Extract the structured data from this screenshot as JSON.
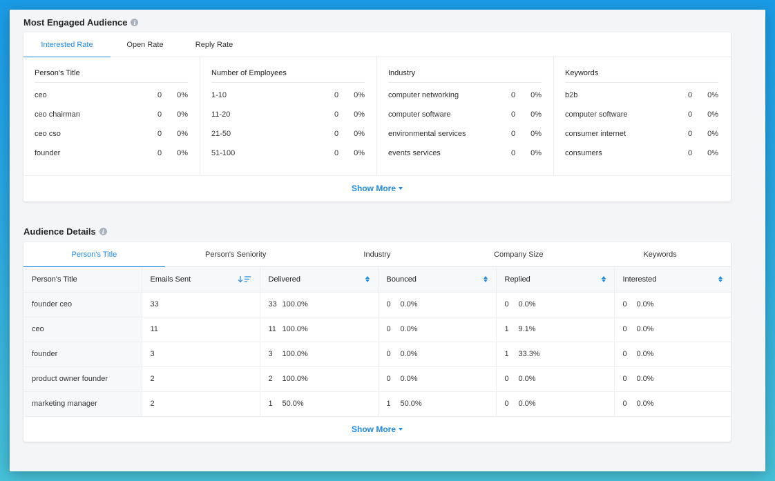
{
  "engaged": {
    "title": "Most Engaged Audience",
    "tabs": [
      {
        "label": "Interested Rate"
      },
      {
        "label": "Open Rate"
      },
      {
        "label": "Reply Rate"
      }
    ],
    "columns": [
      {
        "heading": "Person's Title",
        "rows": [
          {
            "name": "ceo",
            "count": "0",
            "pct": "0%"
          },
          {
            "name": "ceo chairman",
            "count": "0",
            "pct": "0%"
          },
          {
            "name": "ceo cso",
            "count": "0",
            "pct": "0%"
          },
          {
            "name": "founder",
            "count": "0",
            "pct": "0%"
          }
        ]
      },
      {
        "heading": "Number of Employees",
        "rows": [
          {
            "name": "1-10",
            "count": "0",
            "pct": "0%"
          },
          {
            "name": "11-20",
            "count": "0",
            "pct": "0%"
          },
          {
            "name": "21-50",
            "count": "0",
            "pct": "0%"
          },
          {
            "name": "51-100",
            "count": "0",
            "pct": "0%"
          }
        ]
      },
      {
        "heading": "Industry",
        "rows": [
          {
            "name": "computer networking",
            "count": "0",
            "pct": "0%"
          },
          {
            "name": "computer software",
            "count": "0",
            "pct": "0%"
          },
          {
            "name": "environmental services",
            "count": "0",
            "pct": "0%"
          },
          {
            "name": "events services",
            "count": "0",
            "pct": "0%"
          }
        ]
      },
      {
        "heading": "Keywords",
        "rows": [
          {
            "name": "b2b",
            "count": "0",
            "pct": "0%"
          },
          {
            "name": "computer software",
            "count": "0",
            "pct": "0%"
          },
          {
            "name": "consumer internet",
            "count": "0",
            "pct": "0%"
          },
          {
            "name": "consumers",
            "count": "0",
            "pct": "0%"
          }
        ]
      }
    ],
    "show_more": "Show More"
  },
  "details": {
    "title": "Audience Details",
    "tabs": [
      {
        "label": "Person's Title"
      },
      {
        "label": "Person's Seniority"
      },
      {
        "label": "Industry"
      },
      {
        "label": "Company Size"
      },
      {
        "label": "Keywords"
      }
    ],
    "headers": [
      "Person's Title",
      "Emails Sent",
      "Delivered",
      "Bounced",
      "Replied",
      "Interested"
    ],
    "rows": [
      {
        "title": "founder ceo",
        "sent": "33",
        "delivered": [
          "33",
          "100.0%"
        ],
        "bounced": [
          "0",
          "0.0%"
        ],
        "replied": [
          "0",
          "0.0%"
        ],
        "interested": [
          "0",
          "0.0%"
        ]
      },
      {
        "title": "ceo",
        "sent": "11",
        "delivered": [
          "11",
          "100.0%"
        ],
        "bounced": [
          "0",
          "0.0%"
        ],
        "replied": [
          "1",
          "9.1%"
        ],
        "interested": [
          "0",
          "0.0%"
        ]
      },
      {
        "title": "founder",
        "sent": "3",
        "delivered": [
          "3",
          "100.0%"
        ],
        "bounced": [
          "0",
          "0.0%"
        ],
        "replied": [
          "1",
          "33.3%"
        ],
        "interested": [
          "0",
          "0.0%"
        ]
      },
      {
        "title": "product owner founder",
        "sent": "2",
        "delivered": [
          "2",
          "100.0%"
        ],
        "bounced": [
          "0",
          "0.0%"
        ],
        "replied": [
          "0",
          "0.0%"
        ],
        "interested": [
          "0",
          "0.0%"
        ]
      },
      {
        "title": "marketing manager",
        "sent": "2",
        "delivered": [
          "1",
          "50.0%"
        ],
        "bounced": [
          "1",
          "50.0%"
        ],
        "replied": [
          "0",
          "0.0%"
        ],
        "interested": [
          "0",
          "0.0%"
        ]
      }
    ],
    "show_more": "Show More"
  },
  "colors": {
    "accent": "#1e88e5",
    "info_icon": "#aab2bd"
  },
  "icons": {
    "info": "info-icon",
    "sort": "sort-icon",
    "sort_desc": "sort-desc-icon",
    "caret": "caret-down-icon"
  }
}
